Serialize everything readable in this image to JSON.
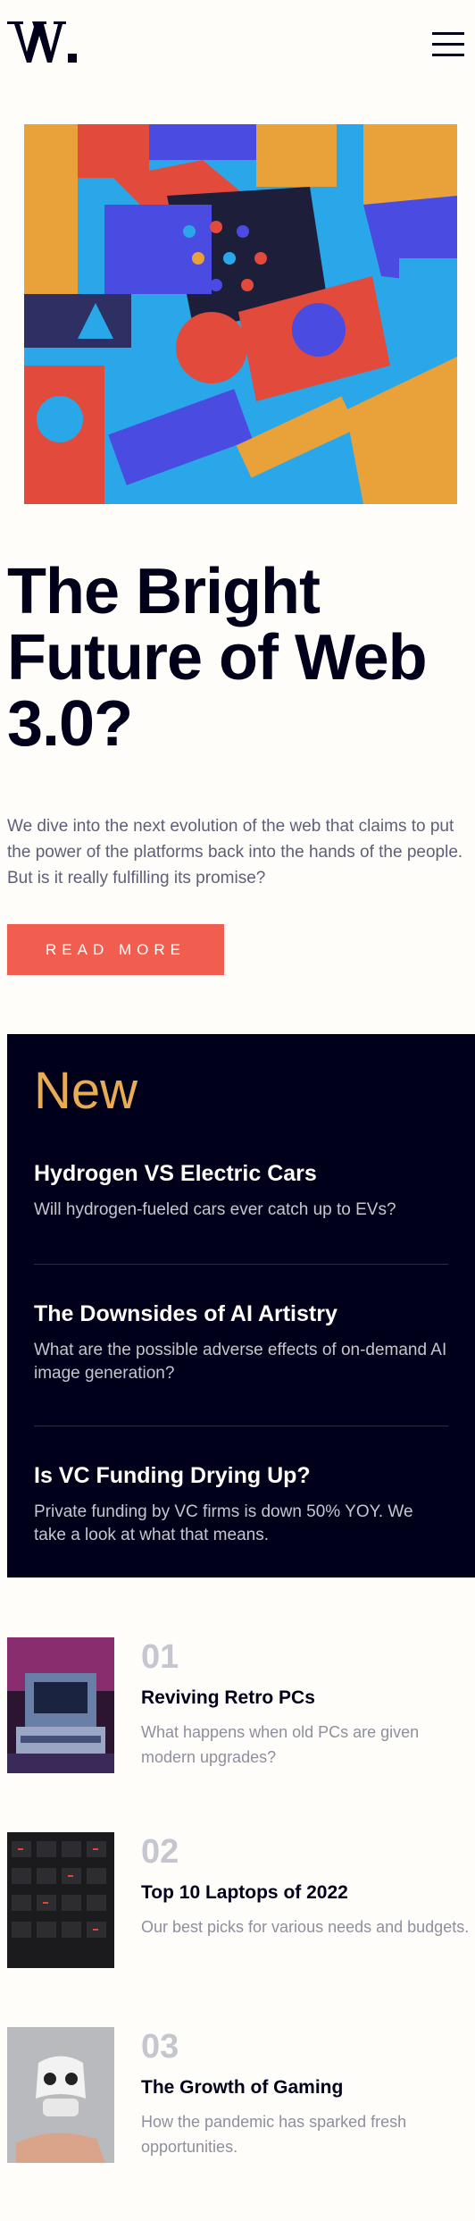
{
  "header": {
    "logo_text": "W.",
    "menu_icon": "hamburger-menu-icon"
  },
  "hero": {
    "image_subject": "3D abstract geometric shapes",
    "headline": "The Bright Future of Web 3.0?",
    "lead": "We dive into the next evolution of the web that claims to put the power of the platforms back into the hands of the people. But is it really fulfilling its promise?",
    "cta_label": "READ MORE"
  },
  "new_section": {
    "title": "New",
    "items": [
      {
        "title": "Hydrogen VS Electric Cars",
        "desc": "Will hydrogen-fueled cars ever catch up to EVs?"
      },
      {
        "title": "The Downsides of AI Artistry",
        "desc": "What are the possible adverse effects of on-demand AI image generation?"
      },
      {
        "title": "Is VC Funding Drying Up?",
        "desc": "Private funding by VC firms is down 50% YOY. We take a look at what that means."
      }
    ]
  },
  "articles": [
    {
      "num": "01",
      "title": "Reviving Retro PCs",
      "desc": "What happens when old PCs are given modern upgrades?"
    },
    {
      "num": "02",
      "title": "Top 10 Laptops of 2022",
      "desc": "Our best picks for various needs and budgets."
    },
    {
      "num": "03",
      "title": "The Growth of Gaming",
      "desc": "How the pandemic has sparked fresh opportunities."
    }
  ],
  "colors": {
    "accent_red": "#f15e50",
    "accent_orange": "#e9ab53",
    "dark_navy": "#00001a",
    "gray_text": "#5d5f79",
    "background": "#fffdfa"
  }
}
